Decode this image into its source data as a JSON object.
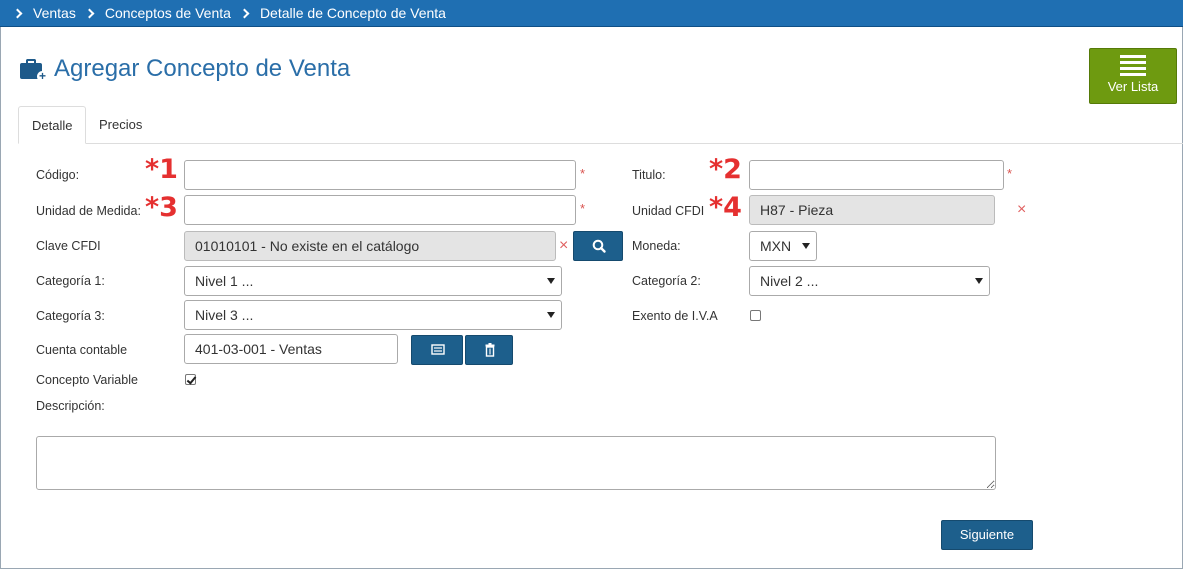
{
  "breadcrumb": [
    "Ventas",
    "Conceptos de Venta",
    "Detalle de Concepto de Venta"
  ],
  "page_title": "Agregar Concepto de Venta",
  "ver_lista_label": "Ver Lista",
  "tabs": [
    "Detalle",
    "Precios"
  ],
  "required_mark": "*",
  "clear_mark": "×",
  "annotations": [
    "*1",
    "*2",
    "*3",
    "*4"
  ],
  "form": {
    "codigo_label": "Código:",
    "codigo_value": "",
    "titulo_label": "Titulo:",
    "titulo_value": "",
    "unidad_medida_label": "Unidad de Medida:",
    "unidad_medida_value": "",
    "unidad_cfdi_label": "Unidad CFDI",
    "unidad_cfdi_value": "H87 - Pieza",
    "clave_cfdi_label": "Clave CFDI",
    "clave_cfdi_value": "01010101 - No existe en el catálogo",
    "moneda_label": "Moneda:",
    "moneda_value": "MXN",
    "categoria1_label": "Categoría 1:",
    "categoria1_value": "Nivel 1 ...",
    "categoria2_label": "Categoría 2:",
    "categoria2_value": "Nivel 2 ...",
    "categoria3_label": "Categoría 3:",
    "categoria3_value": "Nivel 3 ...",
    "exento_iva_label": "Exento de I.V.A",
    "exento_iva_checked": false,
    "cuenta_contable_label": "Cuenta contable",
    "cuenta_contable_value": "401-03-001 - Ventas",
    "concepto_variable_label": "Concepto Variable",
    "concepto_variable_checked": true,
    "descripcion_label": "Descripción:",
    "descripcion_value": ""
  },
  "siguiente_label": "Siguiente",
  "colors": {
    "header_blue": "#1f6fb2",
    "title_blue": "#2a6ea8",
    "button_blue": "#1d5f8c",
    "button_green": "#6e9a10",
    "required_red": "#e53030"
  }
}
